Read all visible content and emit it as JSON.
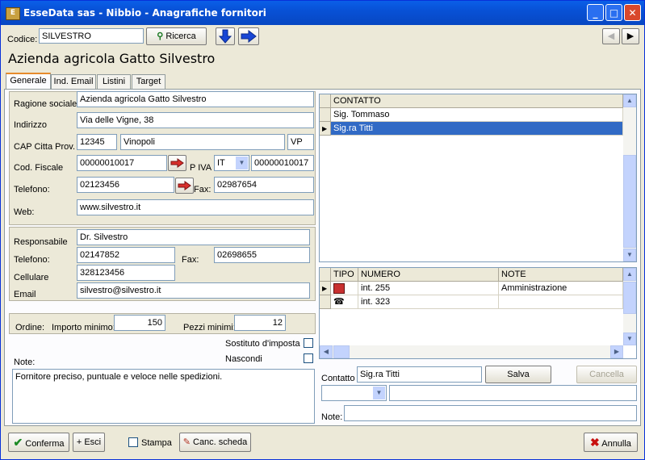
{
  "window": {
    "title": "EsseData sas - Nibbio - Anagrafiche fornitori"
  },
  "toolbar": {
    "codice_label": "Codice:",
    "codice_value": "SILVESTRO",
    "ricerca_label": "Ricerca"
  },
  "header": {
    "company_name": "Azienda agricola Gatto Silvestro"
  },
  "tabs": [
    {
      "label": "Generale"
    },
    {
      "label": "Ind. Email"
    },
    {
      "label": "Listini"
    },
    {
      "label": "Target"
    }
  ],
  "form": {
    "ragione_sociale_label": "Ragione sociale",
    "ragione_sociale": "Azienda agricola Gatto Silvestro",
    "indirizzo_label": "Indirizzo",
    "indirizzo": "Via delle Vigne, 38",
    "cap_label": "CAP Citta Prov.",
    "cap": "12345",
    "citta": "Vinopoli",
    "prov": "VP",
    "cod_fiscale_label": "Cod. Fiscale",
    "cod_fiscale": "00000010017",
    "piva_label": "P IVA",
    "piva_country": "IT",
    "piva": "00000010017",
    "telefono_label": "Telefono:",
    "telefono": "02123456",
    "fax_label": "Fax:",
    "fax": "02987654",
    "web_label": "Web:",
    "web": "www.silvestro.it"
  },
  "responsabile": {
    "responsabile_label": "Responsabile",
    "responsabile": "Dr. Silvestro",
    "telefono_label": "Telefono:",
    "telefono": "02147852",
    "fax_label": "Fax:",
    "fax": "02698655",
    "cellulare_label": "Cellulare",
    "cellulare": "328123456",
    "email_label": "Email",
    "email": "silvestro@silvestro.it"
  },
  "ordine": {
    "ordine_label": "Ordine:",
    "importo_label": "Importo minimo:",
    "importo": "150",
    "pezzi_label": "Pezzi minimi:",
    "pezzi": "12"
  },
  "options": {
    "sostituto_label": "Sostituto d'imposta",
    "nascondi_label": "Nascondi"
  },
  "note": {
    "label": "Note:",
    "text": "Fornitore preciso, puntuale e veloce nelle spedizioni."
  },
  "contacts": {
    "header": "CONTATTO",
    "rows": [
      {
        "name": "Sig. Tommaso"
      },
      {
        "name": "Sig.ra Titti"
      }
    ]
  },
  "numbers": {
    "headers": {
      "tipo": "TIPO",
      "numero": "NUMERO",
      "note": "NOTE"
    },
    "rows": [
      {
        "tipo_icon": "fax-icon",
        "numero": "int. 255",
        "note": "Amministrazione"
      },
      {
        "tipo_icon": "phone-icon",
        "numero": "int. 323",
        "note": ""
      }
    ]
  },
  "contact_edit": {
    "contatto_label": "Contatto",
    "contatto_value": "Sig.ra Titti",
    "salva_label": "Salva",
    "cancella_label": "Cancella",
    "note_label": "Note:"
  },
  "bottom": {
    "conferma_label": "Conferma",
    "esci_label": "+ Esci",
    "stampa_label": "Stampa",
    "canc_label": "Canc. scheda",
    "annulla_label": "Annulla"
  },
  "colors": {
    "title_bar": "#0a5fe8",
    "selection": "#316ac5",
    "accent_arrow": "#d9302c"
  }
}
